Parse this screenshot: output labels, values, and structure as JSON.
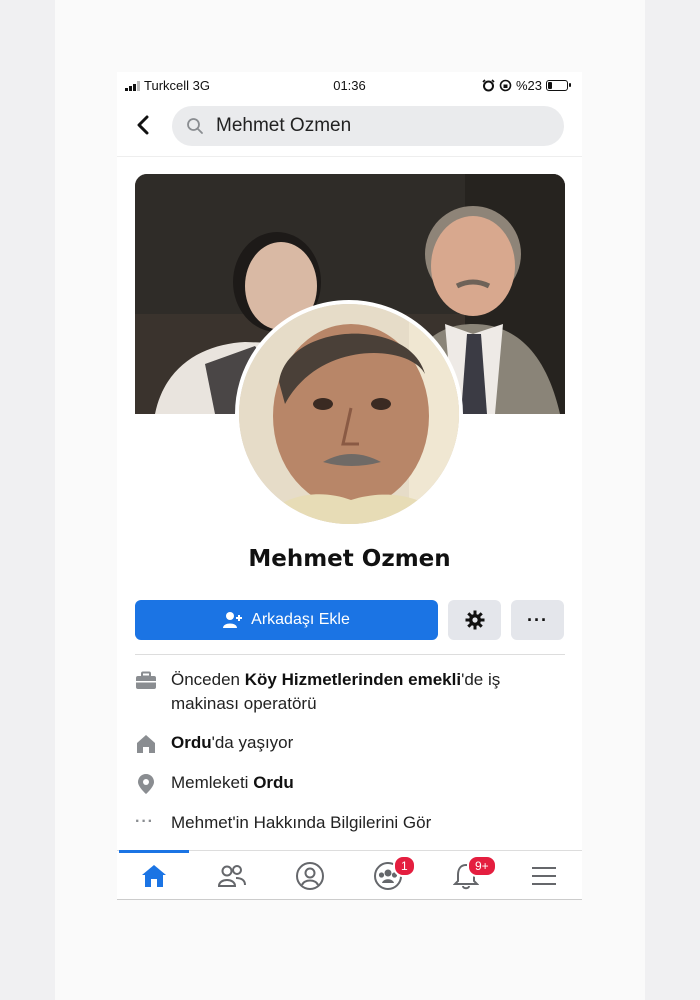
{
  "status_bar": {
    "carrier": "Turkcell 3G",
    "time": "01:36",
    "battery_text": "%23",
    "battery_level": 0.23
  },
  "search": {
    "query": "Mehmet Ozmen",
    "back_icon": "chevron-left-icon",
    "search_icon": "magnifier-icon"
  },
  "profile": {
    "name": "Mehmet Ozmen"
  },
  "actions": {
    "add_friend_label": "Arkadaşı Ekle",
    "add_friend_icon": "person-add-icon",
    "settings_icon": "gear-icon",
    "more_label": "···"
  },
  "about": {
    "work_prefix": "Önceden ",
    "work_org": "Köy Hizmetlerinden emekli",
    "work_suffix": "'de iş makinası operatörü",
    "lives_city": "Ordu",
    "lives_suffix": "'da yaşıyor",
    "hometown_prefix": "Memleketi ",
    "hometown_city": "Ordu",
    "more_dots": "···",
    "see_about": "Mehmet'in Hakkında Bilgilerini Gör"
  },
  "tabbar": {
    "groups_badge": "1",
    "notifications_badge": "9+"
  },
  "colors": {
    "accent": "#1b74e4",
    "badge": "#e41e3f",
    "secondary_button": "#e4e6eb"
  }
}
